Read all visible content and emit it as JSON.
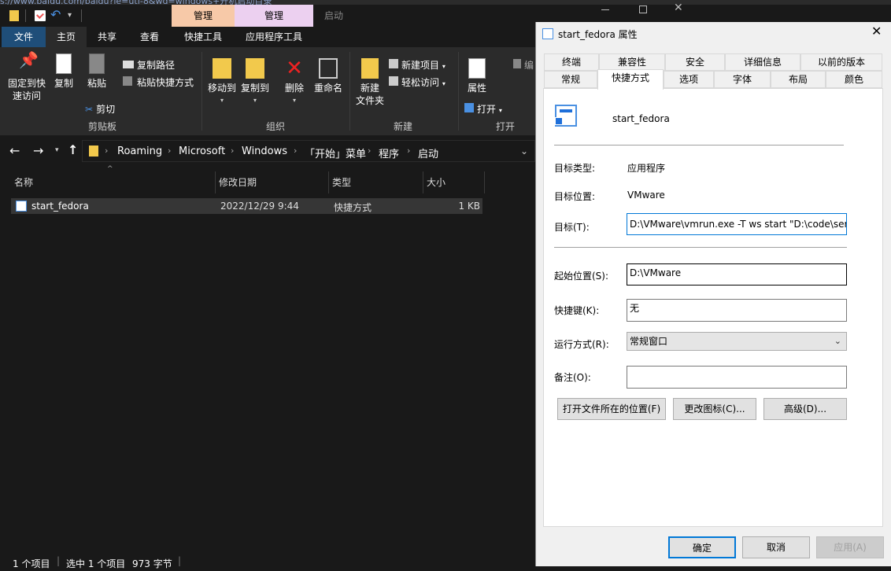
{
  "background_url": "s://www.baidu.com/baidu?ie=utf-8&wd=windows+开机启动目录",
  "explorer": {
    "ctx_tabs": [
      "管理",
      "管理",
      "启动"
    ],
    "ribbon_tabs": [
      "文件",
      "主页",
      "共享",
      "查看",
      "快捷工具",
      "应用程序工具"
    ],
    "clipboard": {
      "pin": "固定到快\n速访问",
      "copy": "复制",
      "paste": "粘贴",
      "copy_path": "复制路径",
      "paste_shortcut": "粘贴快捷方式",
      "cut": "剪切",
      "group": "剪贴板"
    },
    "organize": {
      "move_to": "移动到",
      "copy_to": "复制到",
      "delete": "删除",
      "rename": "重命名",
      "group": "组织"
    },
    "new": {
      "new_folder": "新建\n文件夹",
      "new_item": "新建项目",
      "easy_access": "轻松访问",
      "group": "新建"
    },
    "open": {
      "properties": "属性",
      "open": "打开",
      "edit": "编",
      "group": "打开"
    },
    "breadcrumbs": [
      "Roaming",
      "Microsoft",
      "Windows",
      "「开始」菜单",
      "程序",
      "启动"
    ],
    "columns": [
      "名称",
      "修改日期",
      "类型",
      "大小"
    ],
    "rows": [
      {
        "name": "start_fedora",
        "date": "2022/12/29 9:44",
        "type": "快捷方式",
        "size": "1 KB"
      }
    ],
    "status": {
      "count": "1 个项目",
      "selected": "选中 1 个项目",
      "size": "973 字节"
    }
  },
  "dialog": {
    "title": "start_fedora 属性",
    "tabs_row1": [
      "终端",
      "兼容性",
      "安全",
      "详细信息",
      "以前的版本"
    ],
    "tabs_row2": [
      "常规",
      "快捷方式",
      "选项",
      "字体",
      "布局",
      "颜色"
    ],
    "file_name": "start_fedora",
    "target_type_label": "目标类型:",
    "target_type": "应用程序",
    "target_loc_label": "目标位置:",
    "target_loc": "VMware",
    "target_label": "目标(T):",
    "target_value": "D:\\VMware\\vmrun.exe -T ws start \"D:\\code\\ser",
    "start_label": "起始位置(S):",
    "start_value": "D:\\VMware",
    "hotkey_label": "快捷键(K):",
    "hotkey_value": "无",
    "run_label": "运行方式(R):",
    "run_value": "常规窗口",
    "comment_label": "备注(O):",
    "comment_value": "",
    "btn_open_location": "打开文件所在的位置(F)",
    "btn_change_icon": "更改图标(C)...",
    "btn_advanced": "高级(D)...",
    "ok": "确定",
    "cancel": "取消",
    "apply": "应用(A)"
  }
}
